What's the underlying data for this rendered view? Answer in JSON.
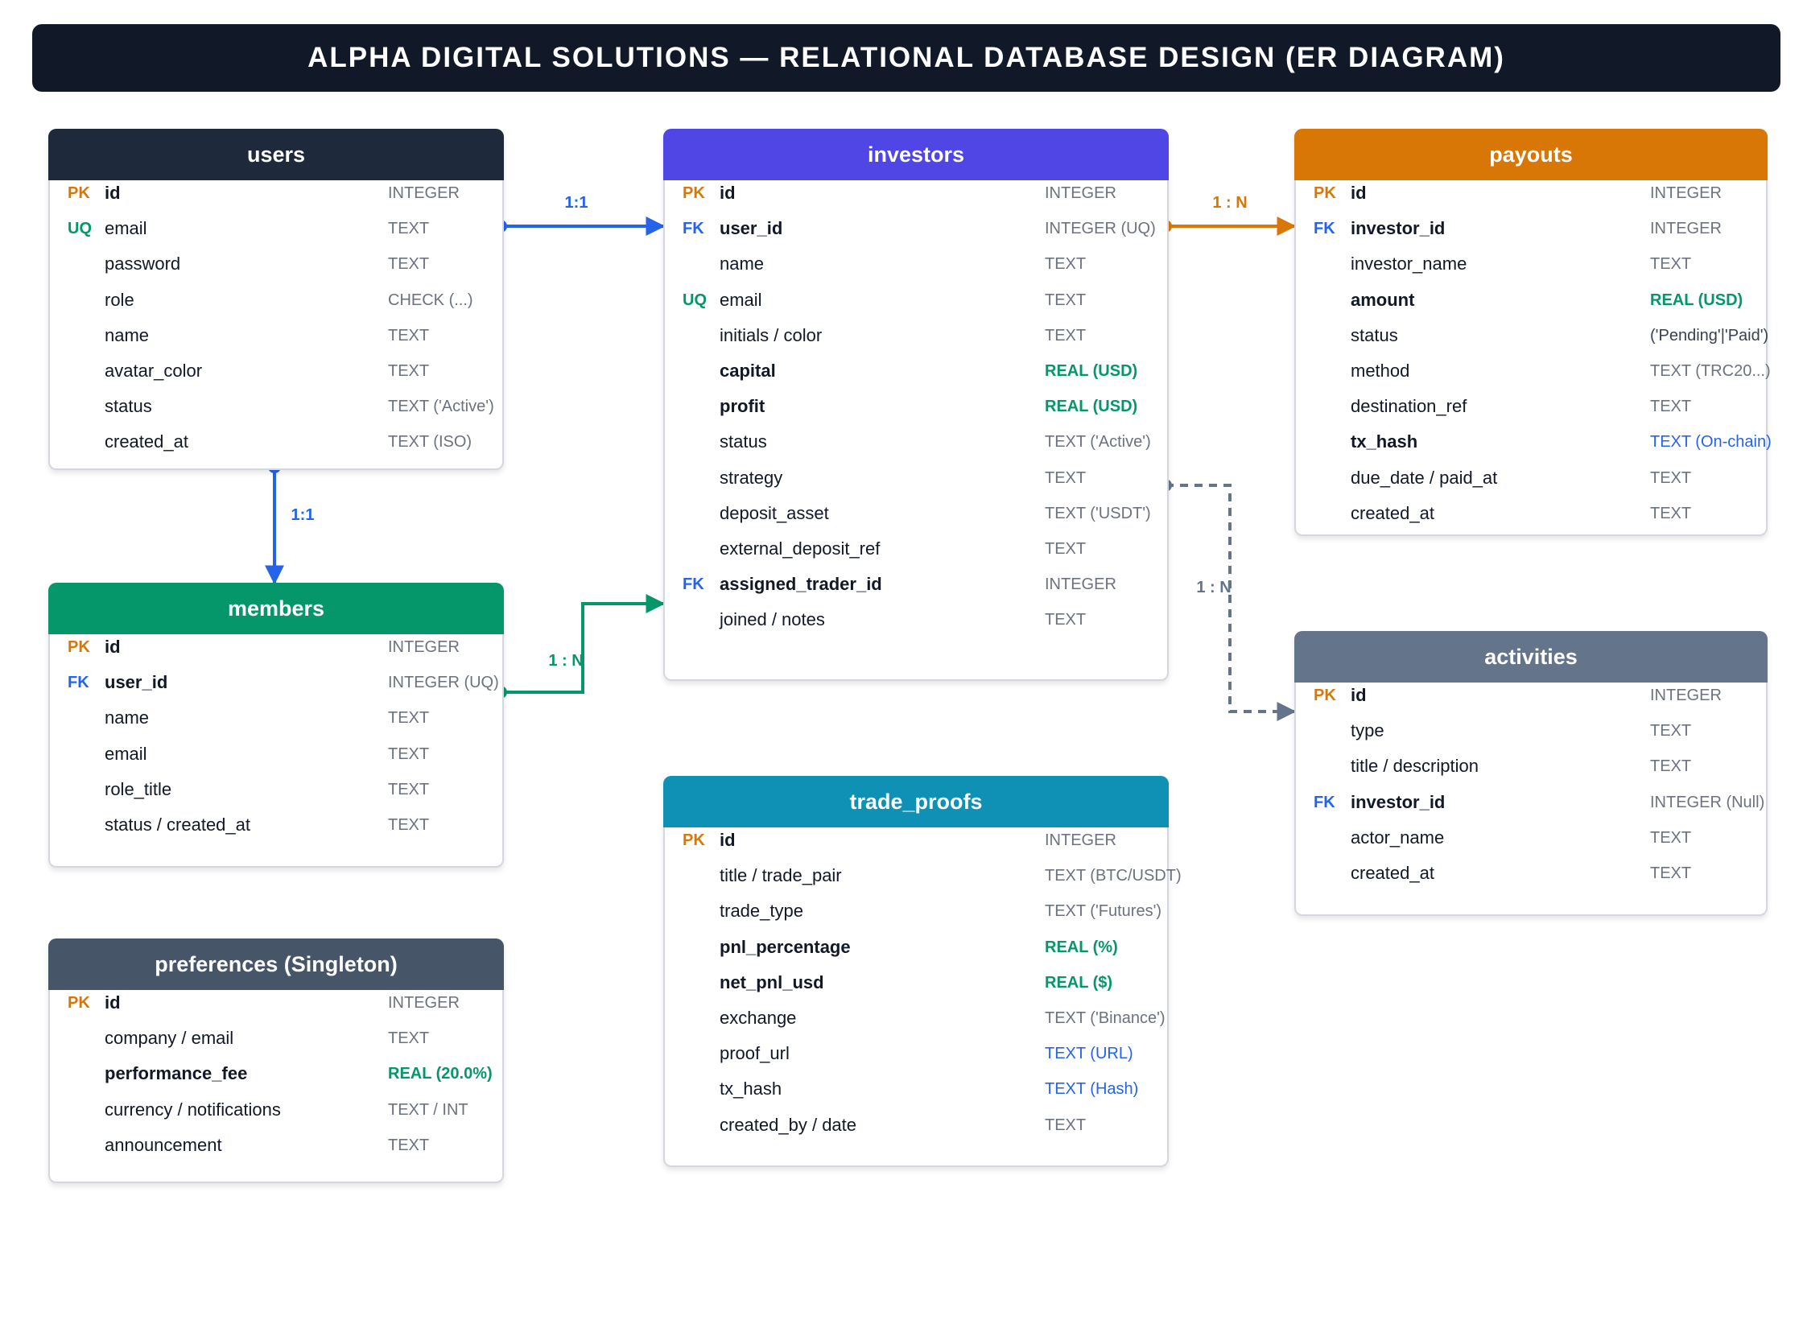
{
  "title": "ALPHA DIGITAL SOLUTIONS — RELATIONAL DATABASE DESIGN (ER DIAGRAM)",
  "colors": {
    "users": "#1e293b",
    "investors": "#4f46e5",
    "payouts": "#d97706",
    "members": "#059669",
    "activities": "#64748b",
    "trade_proofs": "#0e91b5",
    "preferences": "#475569"
  },
  "tables": {
    "users": {
      "name": "users",
      "fields": [
        {
          "key": "PK",
          "name": "id",
          "type": "INTEGER",
          "strong": true
        },
        {
          "key": "UQ",
          "name": "email",
          "type": "TEXT"
        },
        {
          "key": "",
          "name": "password",
          "type": "TEXT"
        },
        {
          "key": "",
          "name": "role",
          "type": "CHECK (...)"
        },
        {
          "key": "",
          "name": "name",
          "type": "TEXT"
        },
        {
          "key": "",
          "name": "avatar_color",
          "type": "TEXT"
        },
        {
          "key": "",
          "name": "status",
          "type": "TEXT ('Active')"
        },
        {
          "key": "",
          "name": "created_at",
          "type": "TEXT (ISO)"
        }
      ]
    },
    "investors": {
      "name": "investors",
      "fields": [
        {
          "key": "PK",
          "name": "id",
          "type": "INTEGER",
          "strong": true
        },
        {
          "key": "FK",
          "name": "user_id",
          "type": "INTEGER (UQ)",
          "strong": true
        },
        {
          "key": "",
          "name": "name",
          "type": "TEXT"
        },
        {
          "key": "UQ",
          "name": "email",
          "type": "TEXT"
        },
        {
          "key": "",
          "name": "initials / color",
          "type": "TEXT"
        },
        {
          "key": "",
          "name": "capital",
          "type": "REAL (USD)",
          "strong": true,
          "type_style": "green"
        },
        {
          "key": "",
          "name": "profit",
          "type": "REAL (USD)",
          "strong": true,
          "type_style": "green"
        },
        {
          "key": "",
          "name": "status",
          "type": "TEXT ('Active')"
        },
        {
          "key": "",
          "name": "strategy",
          "type": "TEXT"
        },
        {
          "key": "",
          "name": "deposit_asset",
          "type": "TEXT ('USDT')"
        },
        {
          "key": "",
          "name": "external_deposit_ref",
          "type": "TEXT"
        },
        {
          "key": "FK",
          "name": "assigned_trader_id",
          "type": "INTEGER",
          "strong": true
        },
        {
          "key": "",
          "name": "joined / notes",
          "type": "TEXT"
        }
      ]
    },
    "payouts": {
      "name": "payouts",
      "fields": [
        {
          "key": "PK",
          "name": "id",
          "type": "INTEGER",
          "strong": true
        },
        {
          "key": "FK",
          "name": "investor_id",
          "type": "INTEGER",
          "strong": true
        },
        {
          "key": "",
          "name": "investor_name",
          "type": "TEXT"
        },
        {
          "key": "",
          "name": "amount",
          "type": "REAL (USD)",
          "strong": true,
          "type_style": "green"
        },
        {
          "key": "",
          "name": "status",
          "type": "('Pending'|'Paid')",
          "type_style": "dark"
        },
        {
          "key": "",
          "name": "method",
          "type": "TEXT (TRC20...)"
        },
        {
          "key": "",
          "name": "destination_ref",
          "type": "TEXT"
        },
        {
          "key": "",
          "name": "tx_hash",
          "type": "TEXT (On-chain)",
          "strong": true,
          "type_style": "blue"
        },
        {
          "key": "",
          "name": "due_date / paid_at",
          "type": "TEXT"
        },
        {
          "key": "",
          "name": "created_at",
          "type": "TEXT"
        }
      ]
    },
    "members": {
      "name": "members",
      "fields": [
        {
          "key": "PK",
          "name": "id",
          "type": "INTEGER",
          "strong": true
        },
        {
          "key": "FK",
          "name": "user_id",
          "type": "INTEGER (UQ)",
          "strong": true
        },
        {
          "key": "",
          "name": "name",
          "type": "TEXT"
        },
        {
          "key": "",
          "name": "email",
          "type": "TEXT"
        },
        {
          "key": "",
          "name": "role_title",
          "type": "TEXT"
        },
        {
          "key": "",
          "name": "status / created_at",
          "type": "TEXT"
        }
      ]
    },
    "activities": {
      "name": "activities",
      "fields": [
        {
          "key": "PK",
          "name": "id",
          "type": "INTEGER",
          "strong": true
        },
        {
          "key": "",
          "name": "type",
          "type": "TEXT"
        },
        {
          "key": "",
          "name": "title / description",
          "type": "TEXT"
        },
        {
          "key": "FK",
          "name": "investor_id",
          "type": "INTEGER (Null)",
          "strong": true
        },
        {
          "key": "",
          "name": "actor_name",
          "type": "TEXT"
        },
        {
          "key": "",
          "name": "created_at",
          "type": "TEXT"
        }
      ]
    },
    "trade_proofs": {
      "name": "trade_proofs",
      "fields": [
        {
          "key": "PK",
          "name": "id",
          "type": "INTEGER",
          "strong": true
        },
        {
          "key": "",
          "name": "title / trade_pair",
          "type": "TEXT (BTC/USDT)"
        },
        {
          "key": "",
          "name": "trade_type",
          "type": "TEXT ('Futures')"
        },
        {
          "key": "",
          "name": "pnl_percentage",
          "type": "REAL (%)",
          "strong": true,
          "type_style": "green"
        },
        {
          "key": "",
          "name": "net_pnl_usd",
          "type": "REAL ($)",
          "strong": true,
          "type_style": "green"
        },
        {
          "key": "",
          "name": "exchange",
          "type": "TEXT ('Binance')"
        },
        {
          "key": "",
          "name": "proof_url",
          "type": "TEXT (URL)",
          "type_style": "blue"
        },
        {
          "key": "",
          "name": "tx_hash",
          "type": "TEXT (Hash)",
          "type_style": "blue"
        },
        {
          "key": "",
          "name": "created_by / date",
          "type": "TEXT"
        }
      ]
    },
    "preferences": {
      "name": "preferences (Singleton)",
      "fields": [
        {
          "key": "PK",
          "name": "id",
          "type": "INTEGER",
          "strong": true
        },
        {
          "key": "",
          "name": "company / email",
          "type": "TEXT"
        },
        {
          "key": "",
          "name": "performance_fee",
          "type": "REAL (20.0%)",
          "strong": true,
          "type_style": "green"
        },
        {
          "key": "",
          "name": "currency / notifications",
          "type": "TEXT / INT"
        },
        {
          "key": "",
          "name": "announcement",
          "type": "TEXT"
        }
      ]
    }
  },
  "relationships": [
    {
      "from": "users",
      "to": "investors",
      "label": "1:1",
      "color": "#2563eb",
      "style": "solid"
    },
    {
      "from": "users",
      "to": "members",
      "label": "1:1",
      "color": "#2563eb",
      "style": "solid"
    },
    {
      "from": "investors",
      "to": "payouts",
      "label": "1 : N",
      "color": "#d97706",
      "style": "solid"
    },
    {
      "from": "members",
      "to": "investors",
      "label": "1 : N",
      "color": "#059669",
      "style": "solid"
    },
    {
      "from": "investors",
      "to": "activities",
      "label": "1 : N",
      "color": "#64748b",
      "style": "dashed"
    }
  ]
}
